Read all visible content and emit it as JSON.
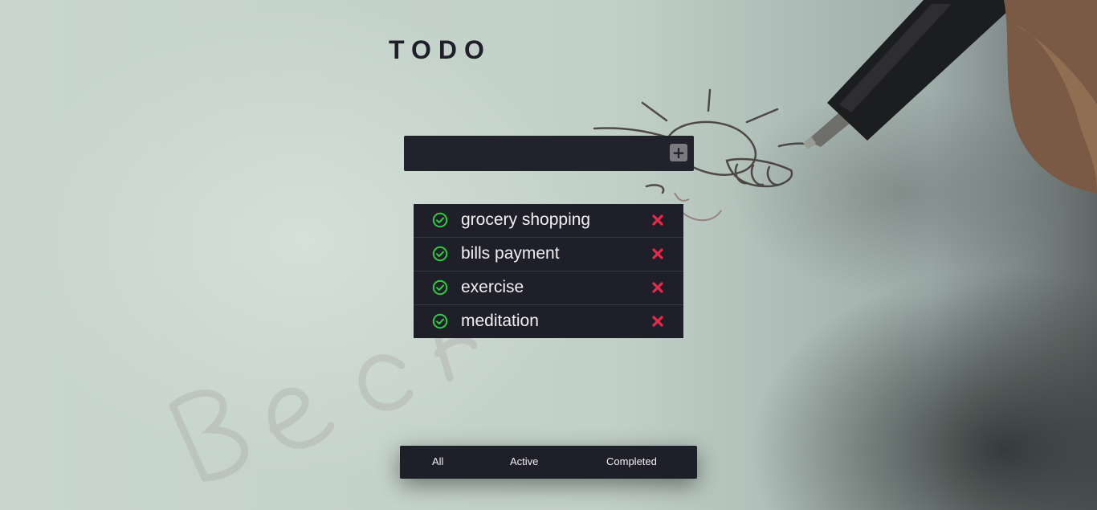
{
  "app": {
    "title": "TODO"
  },
  "add_form": {
    "input_value": "",
    "input_placeholder": "",
    "add_icon": "plus-square-icon"
  },
  "todos": [
    {
      "text": "grocery shopping",
      "complete_icon": "check-circle-icon",
      "delete_icon": "close-icon"
    },
    {
      "text": "bills payment",
      "complete_icon": "check-circle-icon",
      "delete_icon": "close-icon"
    },
    {
      "text": "exercise",
      "complete_icon": "check-circle-icon",
      "delete_icon": "close-icon"
    },
    {
      "text": "meditation",
      "complete_icon": "check-circle-icon",
      "delete_icon": "close-icon"
    }
  ],
  "filters": {
    "all": "All",
    "active": "Active",
    "completed": "Completed"
  },
  "colors": {
    "panel": "#1f1f29",
    "check": "#2ecc40",
    "delete": "#e8294c",
    "text": "#f1f1f3",
    "title": "#1e1f28"
  }
}
